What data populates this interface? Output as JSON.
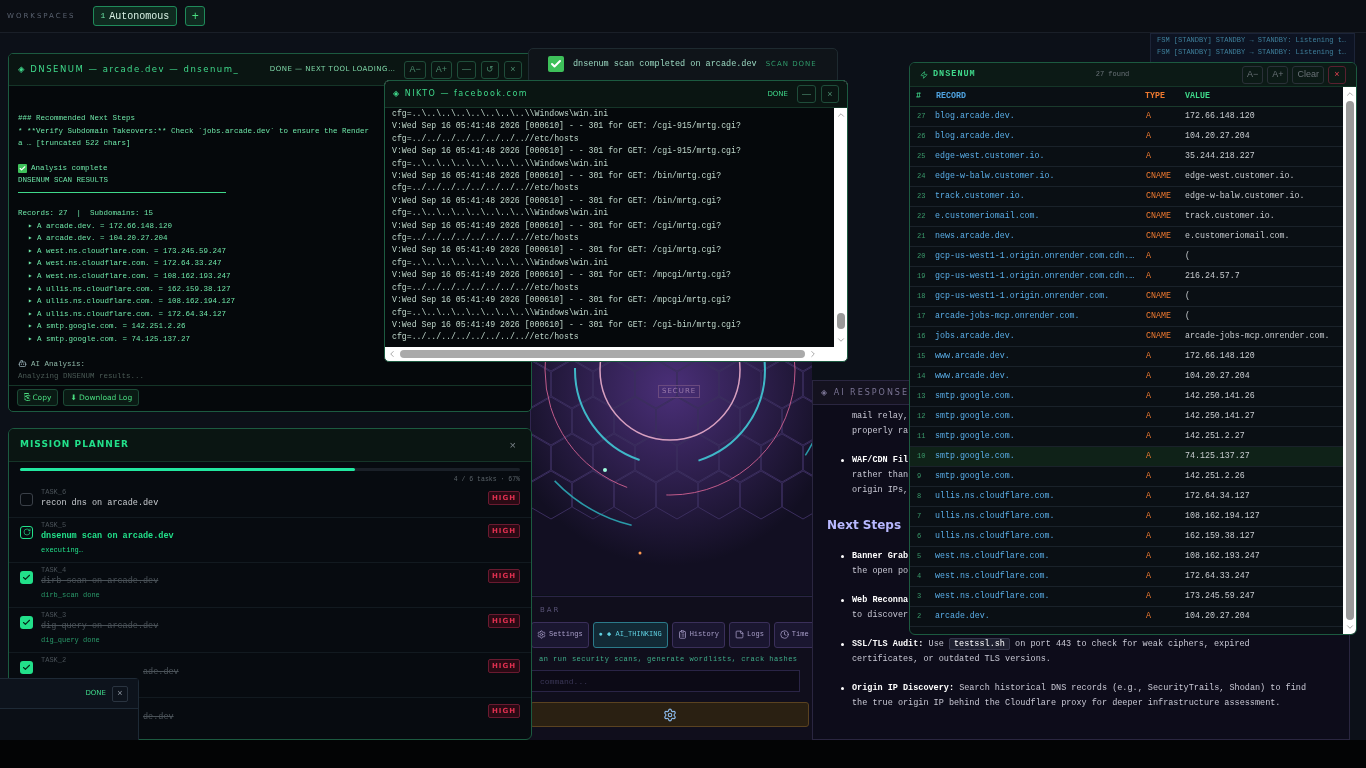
{
  "topbar": {
    "label": "WORKSPACES",
    "workspaces": [
      {
        "number": "1",
        "name": "Autonomous",
        "selected": true
      }
    ],
    "add": "+"
  },
  "fsm_log": [
    "FSM [STANDBY] STANDBY → STANDBY: Listening t…",
    "FSM [STANDBY] STANDBY → STANDBY: Listening t…"
  ],
  "terminal": {
    "title": "◈ DNSENUM — arcade.dev — dnsenum_",
    "status": "DONE — NEXT TOOL LOADING…",
    "controls": [
      "A−",
      "A+",
      "—",
      "↺",
      "×"
    ],
    "lines": [
      {
        "kind": "heading",
        "text": "### Recommended Next Steps"
      },
      {
        "kind": "text",
        "text": "* **Verify Subdomain Takeovers:** Check `jobs.arcade.dev` to ensure the Render"
      },
      {
        "kind": "text",
        "text": "a … [truncated 522 chars]"
      },
      {
        "kind": "check",
        "text": "Analysis complete"
      },
      {
        "kind": "title",
        "text": "DNSENUM SCAN RESULTS"
      },
      {
        "kind": "summary",
        "text": "Records: 27  |  Subdomains: 15"
      },
      {
        "kind": "record",
        "text": "▸ A arcade.dev. = 172.66.148.120"
      },
      {
        "kind": "record",
        "text": "▸ A arcade.dev. = 104.20.27.204"
      },
      {
        "kind": "record",
        "text": "▸ A west.ns.cloudflare.com. = 173.245.59.247"
      },
      {
        "kind": "record",
        "text": "▸ A west.ns.cloudflare.com. = 172.64.33.247"
      },
      {
        "kind": "record",
        "text": "▸ A west.ns.cloudflare.com. = 108.162.193.247"
      },
      {
        "kind": "record",
        "text": "▸ A ullis.ns.cloudflare.com. = 162.159.38.127"
      },
      {
        "kind": "record",
        "text": "▸ A ullis.ns.cloudflare.com. = 108.162.194.127"
      },
      {
        "kind": "record",
        "text": "▸ A ullis.ns.cloudflare.com. = 172.64.34.127"
      },
      {
        "kind": "record",
        "text": "▸ A smtp.google.com. = 142.251.2.26"
      },
      {
        "kind": "record",
        "text": "▸ A smtp.google.com. = 74.125.137.27"
      },
      {
        "kind": "ai",
        "text": "AI Analysis:"
      },
      {
        "kind": "muted",
        "text": "Analyzing DNSENUM results..."
      }
    ],
    "buttons": [
      "⎘ Copy",
      "⬇ Download Log"
    ]
  },
  "toast": {
    "text": "dnsenum scan completed on arcade.dev",
    "status": "SCAN DONE"
  },
  "nikto": {
    "title": "◈ NIKTO — facebook.com",
    "status": "DONE",
    "controls": [
      "—",
      "×"
    ],
    "lines": [
      "cfg=..\\..\\..\\..\\..\\..\\..\\..\\\\Windows\\win.ini",
      "V:Wed Sep 16 05:41:48 2026 [000610] - - 301 for GET: /cgi-915/mrtg.cgi?",
      "cfg=../../../../../../../..//etc/hosts",
      "V:Wed Sep 16 05:41:48 2026 [000610] - - 301 for GET: /cgi-915/mrtg.cgi?",
      "cfg=..\\..\\..\\..\\..\\..\\..\\..\\\\Windows\\win.ini",
      "V:Wed Sep 16 05:41:48 2026 [000610] - - 301 for GET: /bin/mrtg.cgi?",
      "cfg=../../../../../../../..//etc/hosts",
      "V:Wed Sep 16 05:41:48 2026 [000610] - - 301 for GET: /bin/mrtg.cgi?",
      "cfg=..\\..\\..\\..\\..\\..\\..\\..\\\\Windows\\win.ini",
      "V:Wed Sep 16 05:41:49 2026 [000610] - - 301 for GET: /cgi/mrtg.cgi?",
      "cfg=../../../../../../../..//etc/hosts",
      "V:Wed Sep 16 05:41:49 2026 [000610] - - 301 for GET: /cgi/mrtg.cgi?",
      "cfg=..\\..\\..\\..\\..\\..\\..\\..\\\\Windows\\win.ini",
      "V:Wed Sep 16 05:41:49 2026 [000610] - - 301 for GET: /mpcgi/mrtg.cgi?",
      "cfg=../../../../../../../..//etc/hosts",
      "V:Wed Sep 16 05:41:49 2026 [000610] - - 301 for GET: /mpcgi/mrtg.cgi?",
      "cfg=..\\..\\..\\..\\..\\..\\..\\..\\\\Windows\\win.ini",
      "V:Wed Sep 16 05:41:49 2026 [000610] - - 301 for GET: /cgi-bin/mrtg.cgi?",
      "cfg=../../../../../../../..//etc/hosts"
    ]
  },
  "radar": {
    "label": "SECURE"
  },
  "command_bar": {
    "title": "BAR",
    "buttons": [
      {
        "label": "Settings",
        "selected": false
      },
      {
        "label": "● ◆ AI_THINKING",
        "selected": true
      },
      {
        "label": "History",
        "selected": false
      },
      {
        "label": "Logs",
        "selected": false
      },
      {
        "label": "Time",
        "selected": false
      }
    ],
    "hint": "an run security scans, generate wordlists, crack hashes",
    "placeholder": "command..."
  },
  "ai_response": {
    "title": "◈ AI RESPONSE",
    "items": [
      {
        "kind": "cut",
        "lines": [
          "mail relay,",
          "properly ra"
        ]
      },
      {
        "kind": "cut",
        "label": "WAF/CDN Fil",
        "lines": [
          "rather than",
          "origin IPs,"
        ]
      },
      {
        "kind": "heading",
        "label": "Next Steps"
      },
      {
        "kind": "cut",
        "label": "Banner Grab",
        "lines": [
          "the open po"
        ]
      },
      {
        "kind": "cut",
        "label": "Web Reconna",
        "lines": [
          "to discover"
        ]
      },
      {
        "kind": "full",
        "label": "SSL/TLS Audit:",
        "before": "Use",
        "code": "testssl.sh",
        "after": "on port 443 to check for weak ciphers, expired certificates, or outdated TLS versions."
      },
      {
        "kind": "full",
        "label": "Origin IP Discovery:",
        "before": "Search historical DNS records (e.g., SecurityTrails, Shodan) to find the true origin IP behind the Cloudflare proxy for deeper infrastructure assessment."
      }
    ]
  },
  "records": {
    "title": "DNSENUM",
    "count": "27 found",
    "controls": [
      "A−",
      "A+",
      "Clear",
      "×"
    ],
    "columns": [
      "#",
      "RECORD",
      "TYPE",
      "VALUE"
    ],
    "rows": [
      {
        "n": "27",
        "record": "blog.arcade.dev.",
        "type": "A",
        "value": "172.66.148.120",
        "selected": false
      },
      {
        "n": "26",
        "record": "blog.arcade.dev.",
        "type": "A",
        "value": "104.20.27.204",
        "selected": false
      },
      {
        "n": "25",
        "record": "edge-west.customer.io.",
        "type": "A",
        "value": "35.244.218.227",
        "selected": false
      },
      {
        "n": "24",
        "record": "edge-w-balw.customer.io.",
        "type": "CNAME",
        "value": "edge-west.customer.io.",
        "selected": false
      },
      {
        "n": "23",
        "record": "track.customer.io.",
        "type": "CNAME",
        "value": "edge-w-balw.customer.io.",
        "selected": false
      },
      {
        "n": "22",
        "record": "e.customeriomail.com.",
        "type": "CNAME",
        "value": "track.customer.io.",
        "selected": false
      },
      {
        "n": "21",
        "record": "news.arcade.dev.",
        "type": "CNAME",
        "value": "e.customeriomail.com.",
        "selected": false
      },
      {
        "n": "20",
        "record": "gcp-us-west1-1.origin.onrender.com.cdn.…",
        "type": "A",
        "value": "(",
        "selected": false
      },
      {
        "n": "19",
        "record": "gcp-us-west1-1.origin.onrender.com.cdn.…",
        "type": "A",
        "value": "216.24.57.7",
        "selected": false
      },
      {
        "n": "18",
        "record": "gcp-us-west1-1.origin.onrender.com.",
        "type": "CNAME",
        "value": "(",
        "selected": false
      },
      {
        "n": "17",
        "record": "arcade-jobs-mcp.onrender.com.",
        "type": "CNAME",
        "value": "(",
        "selected": false
      },
      {
        "n": "16",
        "record": "jobs.arcade.dev.",
        "type": "CNAME",
        "value": "arcade-jobs-mcp.onrender.com.",
        "selected": false
      },
      {
        "n": "15",
        "record": "www.arcade.dev.",
        "type": "A",
        "value": "172.66.148.120",
        "selected": false
      },
      {
        "n": "14",
        "record": "www.arcade.dev.",
        "type": "A",
        "value": "104.20.27.204",
        "selected": false
      },
      {
        "n": "13",
        "record": "smtp.google.com.",
        "type": "A",
        "value": "142.250.141.26",
        "selected": false
      },
      {
        "n": "12",
        "record": "smtp.google.com.",
        "type": "A",
        "value": "142.250.141.27",
        "selected": false
      },
      {
        "n": "11",
        "record": "smtp.google.com.",
        "type": "A",
        "value": "142.251.2.27",
        "selected": false
      },
      {
        "n": "10",
        "record": "smtp.google.com.",
        "type": "A",
        "value": "74.125.137.27",
        "selected": true
      },
      {
        "n": "9",
        "record": "smtp.google.com.",
        "type": "A",
        "value": "142.251.2.26",
        "selected": false
      },
      {
        "n": "8",
        "record": "ullis.ns.cloudflare.com.",
        "type": "A",
        "value": "172.64.34.127",
        "selected": false
      },
      {
        "n": "7",
        "record": "ullis.ns.cloudflare.com.",
        "type": "A",
        "value": "108.162.194.127",
        "selected": false
      },
      {
        "n": "6",
        "record": "ullis.ns.cloudflare.com.",
        "type": "A",
        "value": "162.159.38.127",
        "selected": false
      },
      {
        "n": "5",
        "record": "west.ns.cloudflare.com.",
        "type": "A",
        "value": "108.162.193.247",
        "selected": false
      },
      {
        "n": "4",
        "record": "west.ns.cloudflare.com.",
        "type": "A",
        "value": "172.64.33.247",
        "selected": false
      },
      {
        "n": "3",
        "record": "west.ns.cloudflare.com.",
        "type": "A",
        "value": "173.245.59.247",
        "selected": false
      },
      {
        "n": "2",
        "record": "arcade.dev.",
        "type": "A",
        "value": "104.20.27.204",
        "selected": false
      }
    ]
  },
  "mission": {
    "title": "MISSION PLANNER",
    "close": "×",
    "level": 0.67,
    "progress": "4 / 6 tasks · 67%",
    "tasks": [
      {
        "id": "TASK_6",
        "title": "recon dns on arcade.dev",
        "kind": "todo",
        "checked": false,
        "priority": "HIGH"
      },
      {
        "id": "TASK_5",
        "title": "dnsenum scan on arcade.dev",
        "kind": "running",
        "note": "executing…",
        "priority": "HIGH"
      },
      {
        "id": "TASK_4",
        "title": "dirb scan on arcade.dev",
        "kind": "done",
        "checked": true,
        "note": "dirb_scan done",
        "priority": "HIGH"
      },
      {
        "id": "TASK_3",
        "title": "dig query on arcade.dev",
        "kind": "done",
        "checked": true,
        "note": "dig_query done",
        "priority": "HIGH"
      },
      {
        "id": "TASK_2",
        "title": "ade.dev",
        "kind": "covered",
        "checked": true,
        "priority": "HIGH"
      },
      {
        "title": "de.dev",
        "kind": "covered",
        "priority": "HIGH"
      }
    ]
  },
  "mini_window": {
    "status": "DONE",
    "close": "×"
  }
}
